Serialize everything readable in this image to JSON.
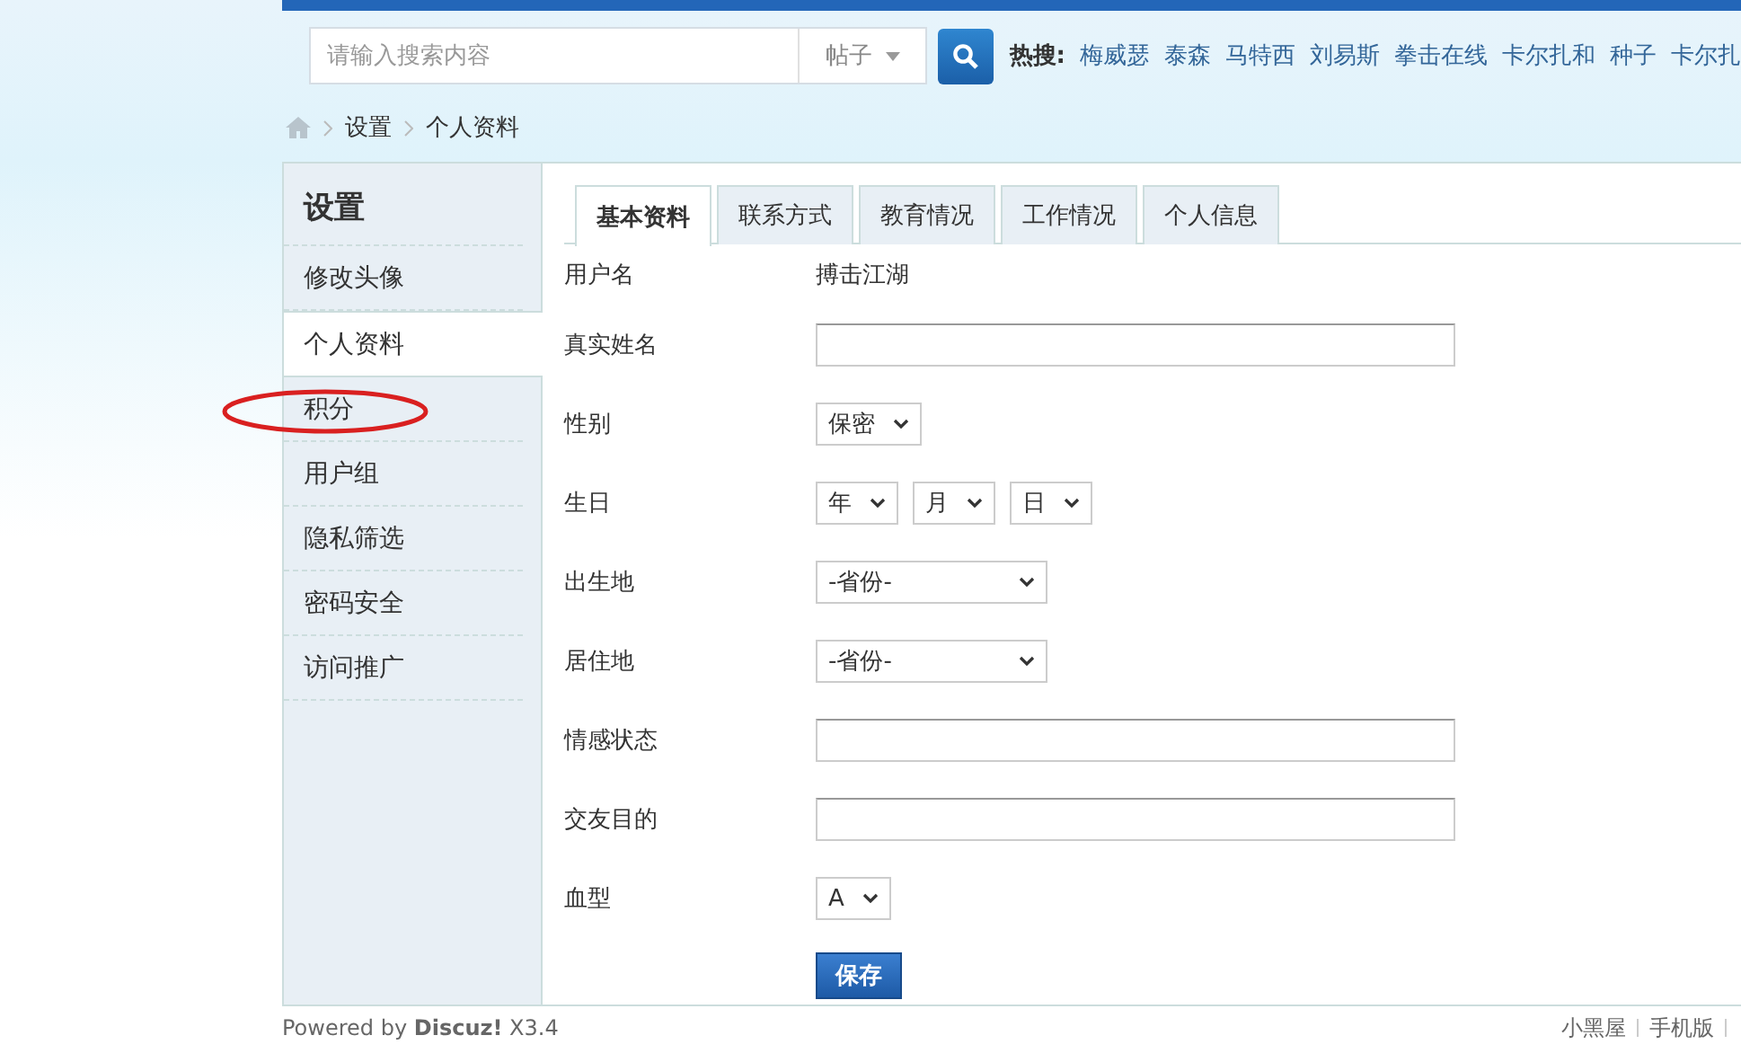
{
  "search": {
    "placeholder": "请输入搜索内容",
    "scope": "帖子"
  },
  "hot_search": {
    "label": "热搜:",
    "terms": [
      "梅威瑟",
      "泰森",
      "马特西",
      "刘易斯",
      "拳击在线",
      "卡尔扎和",
      "种子",
      "卡尔扎"
    ]
  },
  "breadcrumb": [
    "设置",
    "个人资料"
  ],
  "sidebar": {
    "title": "设置",
    "items": [
      {
        "label": "修改头像",
        "selected": false,
        "circled": false
      },
      {
        "label": "个人资料",
        "selected": true,
        "circled": false
      },
      {
        "label": "积分",
        "selected": false,
        "circled": true
      },
      {
        "label": "用户组",
        "selected": false,
        "circled": false
      },
      {
        "label": "隐私筛选",
        "selected": false,
        "circled": false
      },
      {
        "label": "密码安全",
        "selected": false,
        "circled": false
      },
      {
        "label": "访问推广",
        "selected": false,
        "circled": false
      }
    ]
  },
  "tabs": [
    {
      "label": "基本资料",
      "selected": true
    },
    {
      "label": "联系方式",
      "selected": false
    },
    {
      "label": "教育情况",
      "selected": false
    },
    {
      "label": "工作情况",
      "selected": false
    },
    {
      "label": "个人信息",
      "selected": false
    }
  ],
  "fields": [
    {
      "label": "用户名",
      "kind": "text",
      "value": "搏击江湖"
    },
    {
      "label": "真实姓名",
      "kind": "input"
    },
    {
      "label": "性别",
      "kind": "select",
      "selects": [
        "保密"
      ]
    },
    {
      "label": "生日",
      "kind": "select",
      "selects": [
        "年",
        "月",
        "日"
      ]
    },
    {
      "label": "出生地",
      "kind": "select",
      "selects": [
        "-省份-"
      ]
    },
    {
      "label": "居住地",
      "kind": "select",
      "selects": [
        "-省份-"
      ]
    },
    {
      "label": "情感状态",
      "kind": "input"
    },
    {
      "label": "交友目的",
      "kind": "input"
    },
    {
      "label": "血型",
      "kind": "select",
      "selects": [
        "A"
      ]
    }
  ],
  "save_button": "保存",
  "footer": {
    "powered": "Powered by **Discuz!** X3.4",
    "links": [
      "小黑屋",
      "手机版"
    ]
  }
}
